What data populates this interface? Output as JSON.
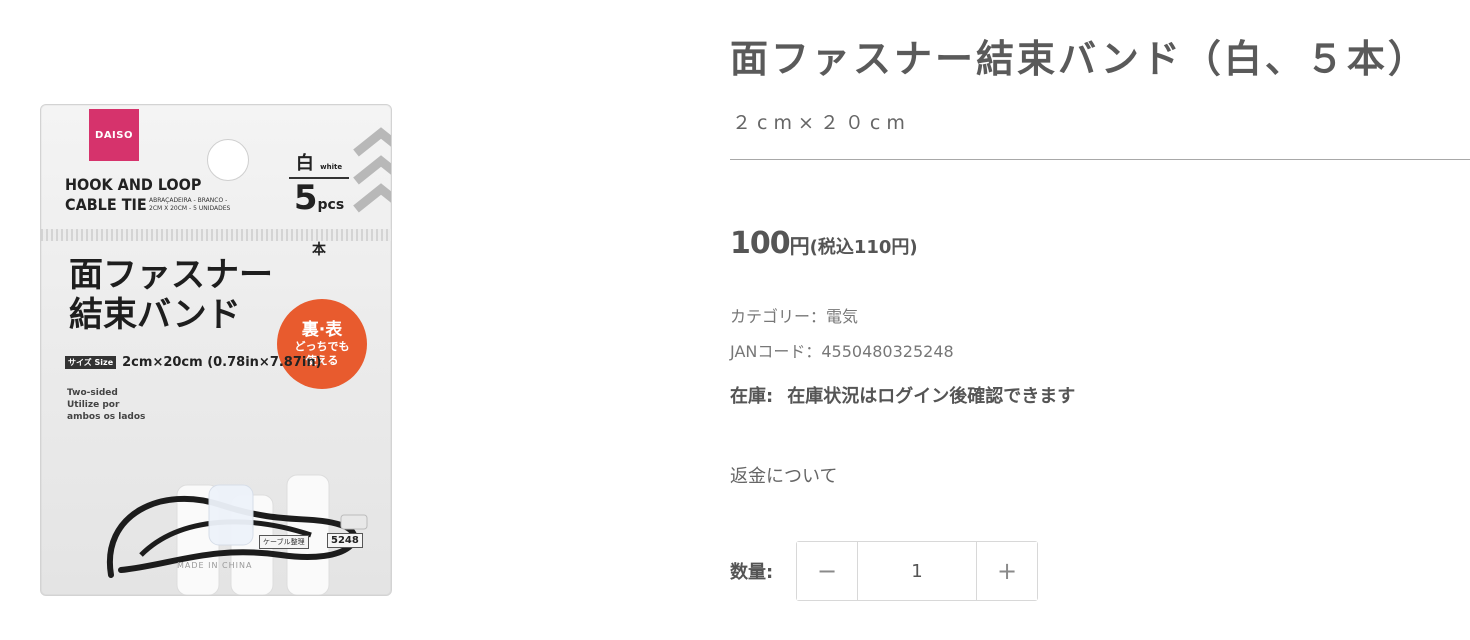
{
  "product": {
    "title": "面ファスナー結束バンド（白、５本）",
    "size": "２cm×２０cm",
    "price": {
      "amount": "100",
      "unit": "円",
      "tax_included": "(税込110円)"
    },
    "category": "カテゴリー：電気",
    "jan": "JANコード：4550480325248",
    "stock": {
      "label": "在庫:",
      "value": "在庫状況はログイン後確認できます"
    },
    "refund_link": "返金について",
    "quantity": {
      "label": "数量:",
      "value": "1",
      "decrement_icon": "minus-icon",
      "increment_icon": "plus-icon"
    }
  },
  "package_image": {
    "brand": "DAISO",
    "english_title": "HOOK AND LOOP\nCABLE TIE",
    "small_languages": "ABRAÇADEIRA - BRANCO - 2CM X 20CM - 5 UNIDADES",
    "color_label": "白",
    "color_label_en": "white",
    "count": "5",
    "count_unit_en": "pcs",
    "count_unit": "本",
    "japanese_title": "面ファスナー\n結束バンド",
    "badge_line1": "裏·表",
    "badge_line2": "どっちでも\n使える",
    "size_tag": "サイズ Size",
    "size_text": "2cm×20cm (0.78in×7.87in)",
    "two_sided_text": "Two-sided\nUtilize por\nambos os lados",
    "category_tag": "ケーブル整理",
    "category_number": "5248",
    "origin": "MADE IN CHINA",
    "accent_color": "#d6336c",
    "badge_color": "#e85b2e"
  }
}
